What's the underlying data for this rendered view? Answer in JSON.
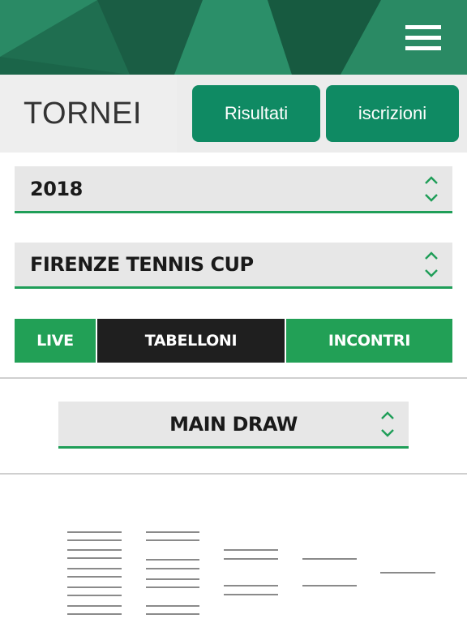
{
  "header": {
    "menu_icon": "hamburger-menu-icon",
    "accent": "#1d6a4c"
  },
  "page": {
    "title": "TORNEI"
  },
  "top_buttons": {
    "results_label": "Risultati",
    "entries_label": "iscrizioni",
    "color": "#0f8a63"
  },
  "filters": {
    "year": {
      "value": "2018"
    },
    "tournament": {
      "value": "FIRENZE TENNIS CUP"
    }
  },
  "tabs": [
    {
      "label": "LIVE",
      "active": false
    },
    {
      "label": "TABELLONI",
      "active": true
    },
    {
      "label": "INCONTRI",
      "active": false
    }
  ],
  "draw_select": {
    "value": "MAIN DRAW"
  },
  "colors": {
    "green": "#22a056",
    "dark": "#1f1f1f",
    "select_bg": "#e7e7e7"
  }
}
